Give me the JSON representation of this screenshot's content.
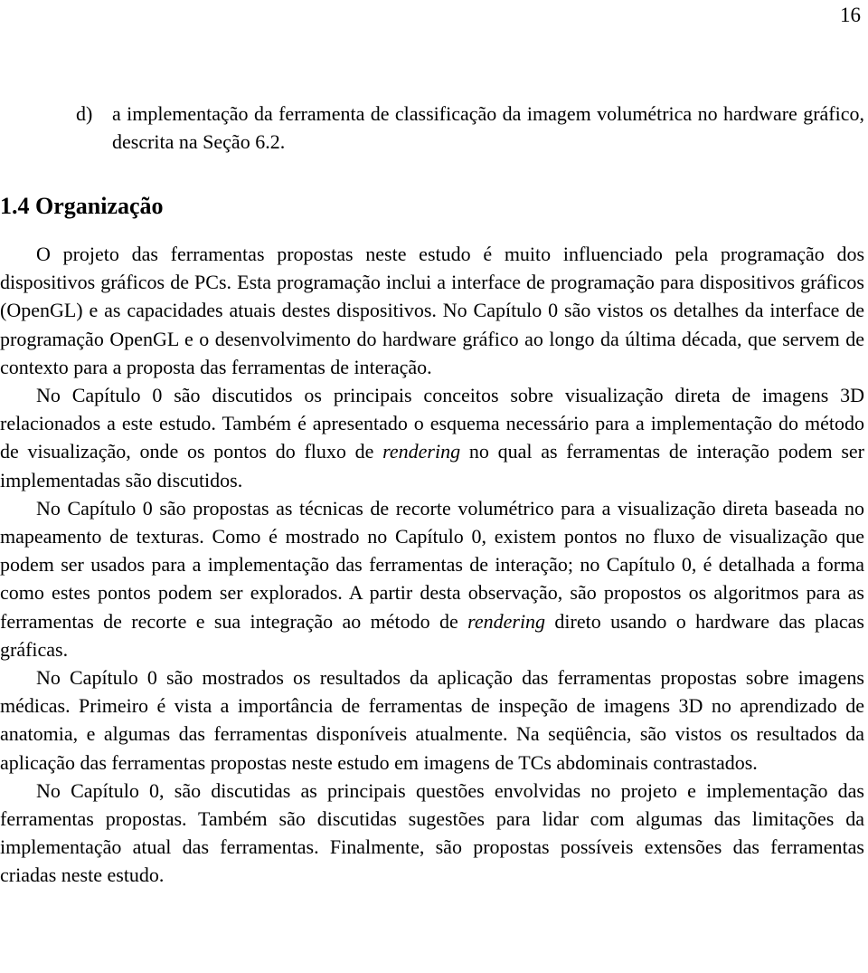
{
  "page_number": "16",
  "list_item": {
    "marker": "d)",
    "text": "a implementação da ferramenta de classificação da imagem volumétrica no hardware gráfico, descrita na Seção 6.2."
  },
  "heading": "1.4 Organização",
  "paragraphs": [
    {
      "segments": [
        "O projeto das ferramentas propostas neste estudo é muito influenciado pela programação dos dispositivos gráficos de PCs. Esta programação inclui a interface de programação para dispositivos gráficos (OpenGL) e as capacidades atuais destes dispositivos. No Capítulo 0 são vistos os detalhes da interface de programação OpenGL e o desenvolvimento do hardware gráfico ao longo da última década, que servem de contexto para a proposta das ferramentas de interação."
      ]
    },
    {
      "segments": [
        "No Capítulo 0 são discutidos os principais conceitos sobre visualização direta de imagens 3D relacionados a este estudo. Também é apresentado o esquema necessário para a implementação do método de visualização, onde os pontos do fluxo de ",
        "rendering",
        " no qual as ferramentas de interação podem ser implementadas são discutidos."
      ]
    },
    {
      "segments": [
        "No Capítulo 0 são propostas as técnicas de recorte volumétrico para a visualização direta baseada no mapeamento de texturas. Como é mostrado no Capítulo 0, existem pontos no fluxo de visualização que podem ser usados para a implementação das ferramentas de interação;  no Capítulo 0, é detalhada a forma como estes pontos podem ser explorados. A partir desta observação, são propostos os algoritmos para as ferramentas de recorte e sua integração ao método de ",
        "rendering",
        " direto usando o hardware das placas gráficas."
      ]
    },
    {
      "segments": [
        "No Capítulo 0 são mostrados os resultados da aplicação das ferramentas propostas sobre imagens médicas. Primeiro é vista a importância de ferramentas de inspeção de imagens 3D no aprendizado de anatomia, e algumas das ferramentas disponíveis atualmente. Na seqüência, são vistos os resultados da aplicação das ferramentas propostas neste estudo em imagens de TCs abdominais contrastados."
      ]
    },
    {
      "segments": [
        "No Capítulo 0, são discutidas as principais questões envolvidas no projeto e implementação das ferramentas propostas. Também são discutidas sugestões para lidar com algumas das limitações da implementação atual das ferramentas. Finalmente, são propostas possíveis extensões das ferramentas criadas neste estudo."
      ]
    }
  ]
}
